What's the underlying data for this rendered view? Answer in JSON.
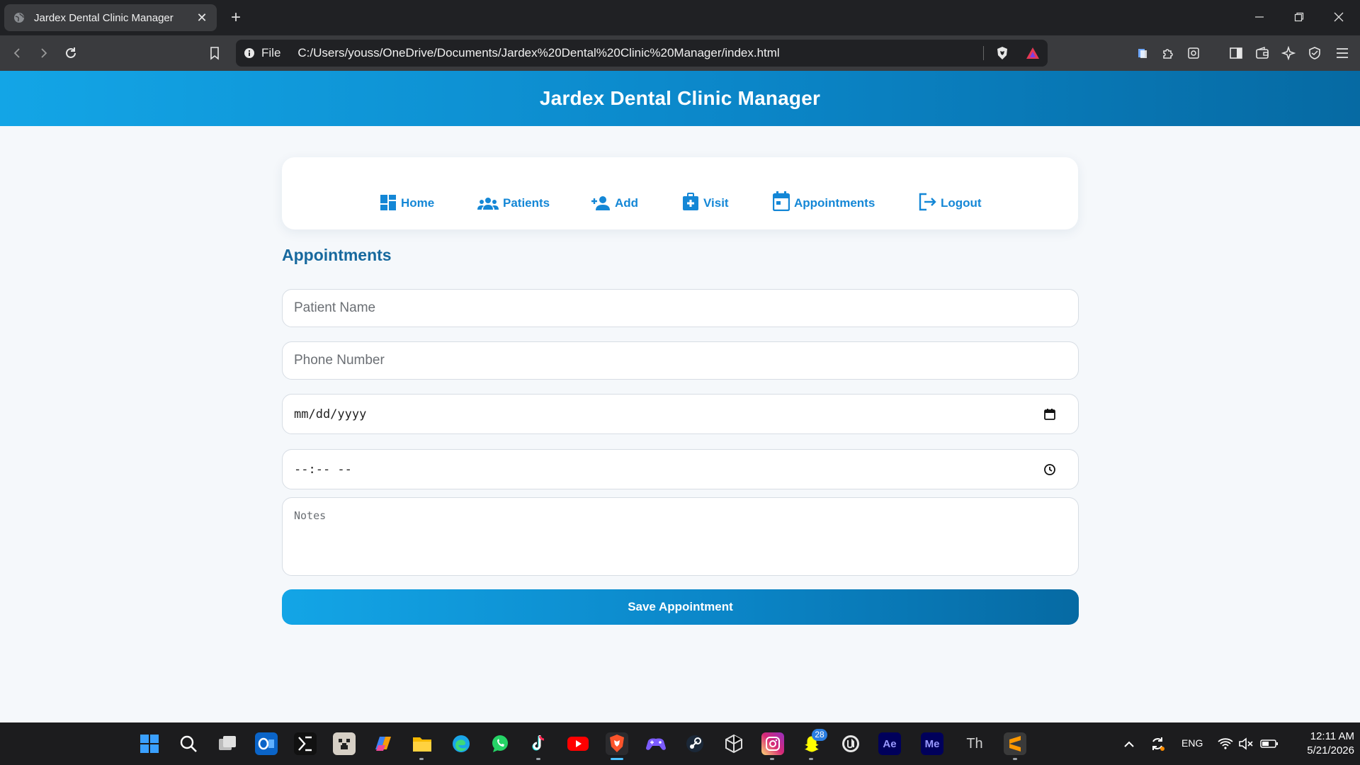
{
  "browser": {
    "tab_title": "Jardex Dental Clinic Manager",
    "new_tab": "+",
    "address_scheme": "File",
    "url": "C:/Users/youss/OneDrive/Documents/Jardex%20Dental%20Clinic%20Manager/index.html"
  },
  "header": {
    "title": "Jardex Dental Clinic Manager"
  },
  "nav": {
    "items": [
      {
        "label": "Home",
        "icon": "dashboard-icon"
      },
      {
        "label": "Patients",
        "icon": "people-icon"
      },
      {
        "label": "Add",
        "icon": "person-add-icon"
      },
      {
        "label": "Visit",
        "icon": "medical-bag-icon"
      },
      {
        "label": "Appointments",
        "icon": "calendar-icon"
      },
      {
        "label": "Logout",
        "icon": "logout-icon"
      }
    ]
  },
  "form": {
    "title": "Appointments",
    "patient_name_placeholder": "Patient Name",
    "phone_placeholder": "Phone Number",
    "date_placeholder": "mm/dd/yyyy",
    "time_placeholder": "--:-- --",
    "notes_placeholder": "Notes",
    "save_label": "Save Appointment"
  },
  "taskbar": {
    "apps": [
      "start",
      "search",
      "task-view",
      "outlook",
      "ide",
      "minecraft",
      "copilot",
      "file-explorer",
      "edge",
      "whatsapp",
      "tiktok",
      "youtube",
      "brave",
      "game",
      "steam",
      "unity",
      "instagram",
      "snapchat",
      "unreal",
      "after-effects",
      "media-encoder",
      "typora",
      "sublime-text"
    ],
    "ae_label": "Ae",
    "me_label": "Me",
    "th_label": "Th",
    "notification_count": "28",
    "language": "ENG",
    "time": "12:11 AM",
    "date": "5/21/2026"
  },
  "colors": {
    "accent": "#1487d6",
    "header_start": "#13a5e6",
    "header_end": "#066aa3",
    "section_title": "#17699e",
    "page_bg": "#f5f8fb"
  }
}
